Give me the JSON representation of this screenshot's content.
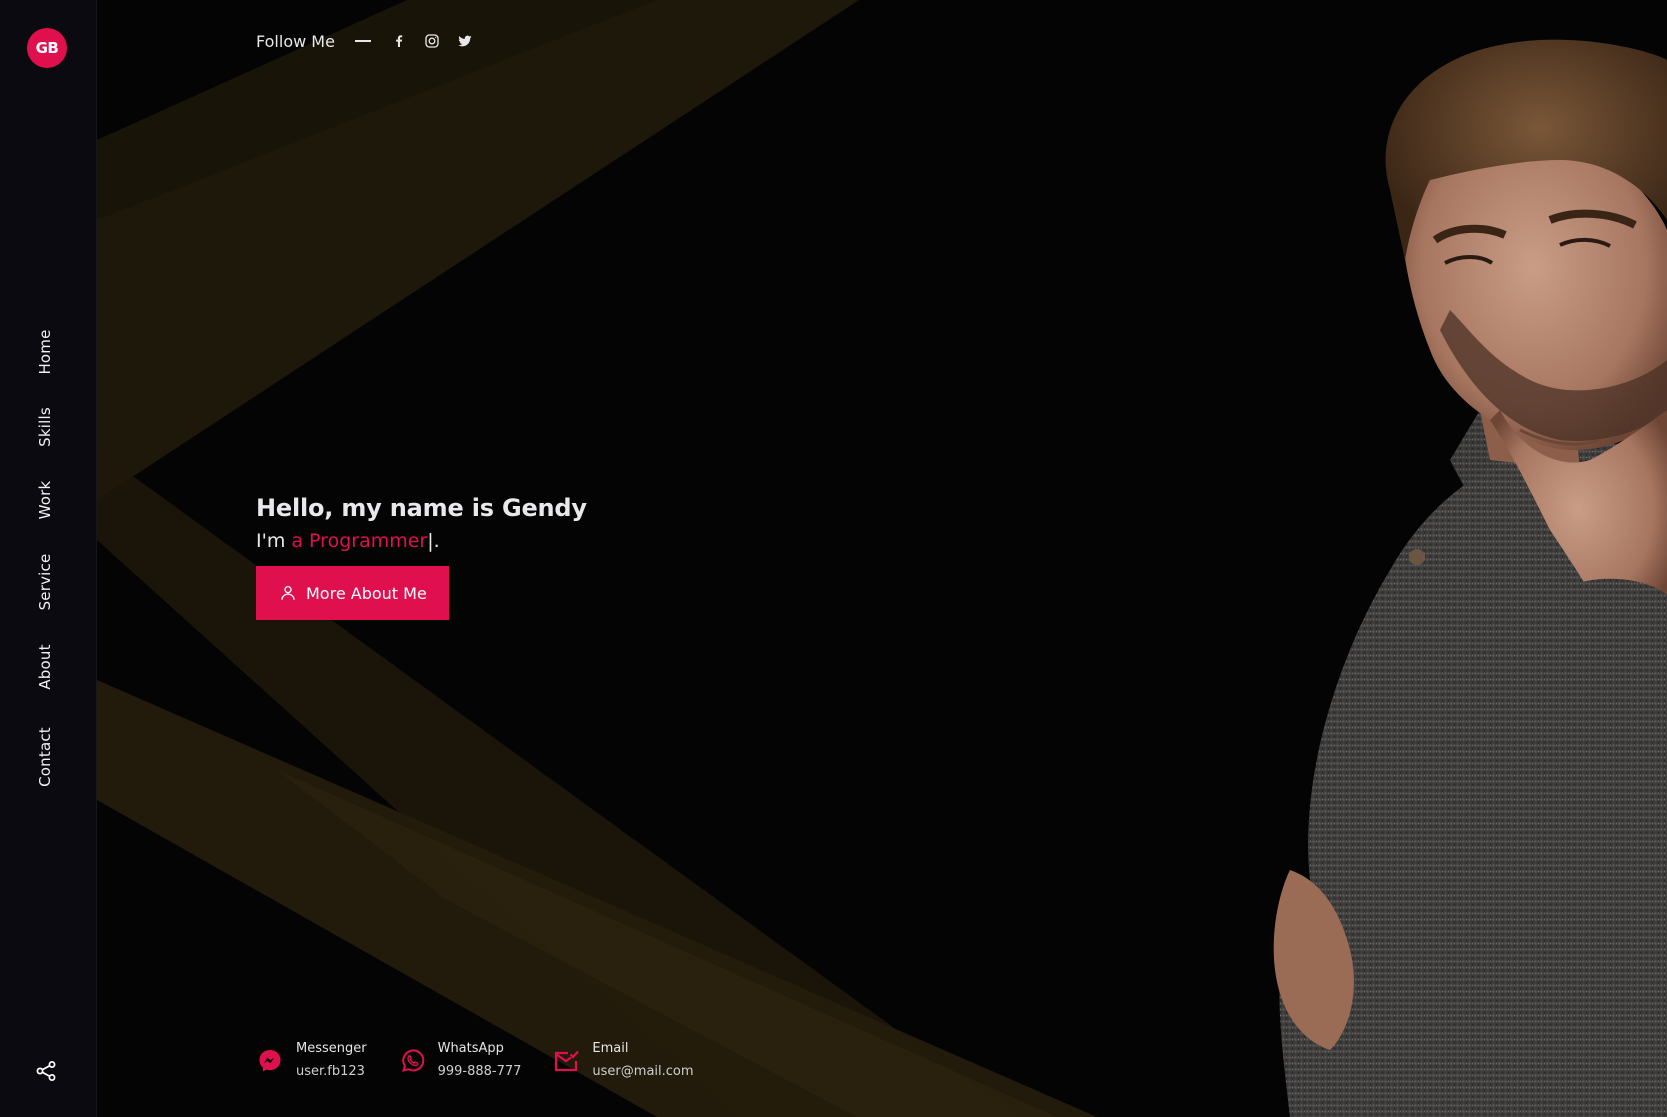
{
  "sidebar": {
    "logo": "GB",
    "nav": [
      {
        "label": "Home"
      },
      {
        "label": "Skills"
      },
      {
        "label": "Work"
      },
      {
        "label": "Service"
      },
      {
        "label": "About"
      },
      {
        "label": "Contact"
      }
    ],
    "share_icon": "share-icon"
  },
  "header": {
    "follow_label": "Follow Me",
    "socials": [
      {
        "icon": "facebook-icon"
      },
      {
        "icon": "instagram-icon"
      },
      {
        "icon": "twitter-icon"
      }
    ]
  },
  "hero": {
    "title": "Hello, my name is Gendy",
    "sub_prefix": "I'm ",
    "sub_accent": "a Programmer",
    "sub_cursor": "|",
    "sub_suffix": ".",
    "button_label": "More About Me",
    "button_icon": "user-icon"
  },
  "contacts": [
    {
      "icon": "messenger-icon",
      "label": "Messenger",
      "value": "user.fb123"
    },
    {
      "icon": "whatsapp-icon",
      "label": "WhatsApp",
      "value": "999-888-777"
    },
    {
      "icon": "email-icon",
      "label": "Email",
      "value": "user@mail.com"
    }
  ],
  "colors": {
    "accent": "#e0104f",
    "background": "#040404",
    "sidebar": "#0b0a10",
    "beam": "#2a200e"
  }
}
